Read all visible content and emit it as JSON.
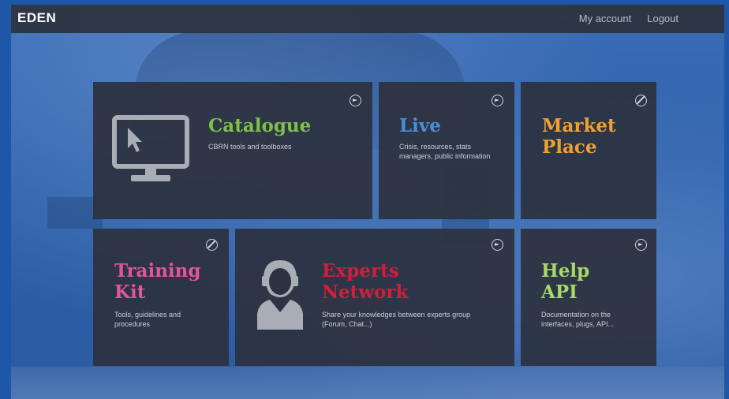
{
  "app": {
    "brand": "EDEN"
  },
  "nav": {
    "links": [
      {
        "label": "My account"
      },
      {
        "label": "Logout"
      }
    ]
  },
  "tiles": {
    "catalogue": {
      "title": "Catalogue",
      "description": "CBRN tools and toolboxes",
      "color": "#7cc246",
      "icon": "monitor-cursor-icon",
      "status": "open"
    },
    "live": {
      "title": "Live",
      "description": "Crisis, resources, stats managers, public information",
      "color": "#4b8fd9",
      "status": "open"
    },
    "market": {
      "title_line1": "Market",
      "title_line2": "Place",
      "color": "#f0a030",
      "status": "disabled"
    },
    "training": {
      "title_line1": "Training",
      "title_line2": "Kit",
      "description": "Tools, guidelines and procedures",
      "color": "#e2559a",
      "status": "disabled"
    },
    "experts": {
      "title_line1": "Experts",
      "title_line2": "Network",
      "description": "Share your knowledges between experts group (Forum, Chat...)",
      "color": "#d01f3c",
      "icon": "operator-headset-icon",
      "status": "open"
    },
    "help": {
      "title_line1": "Help",
      "title_line2": "API",
      "description": "Documentation on the interfaces, plugs, API...",
      "color": "#a7d86a",
      "status": "open"
    }
  }
}
